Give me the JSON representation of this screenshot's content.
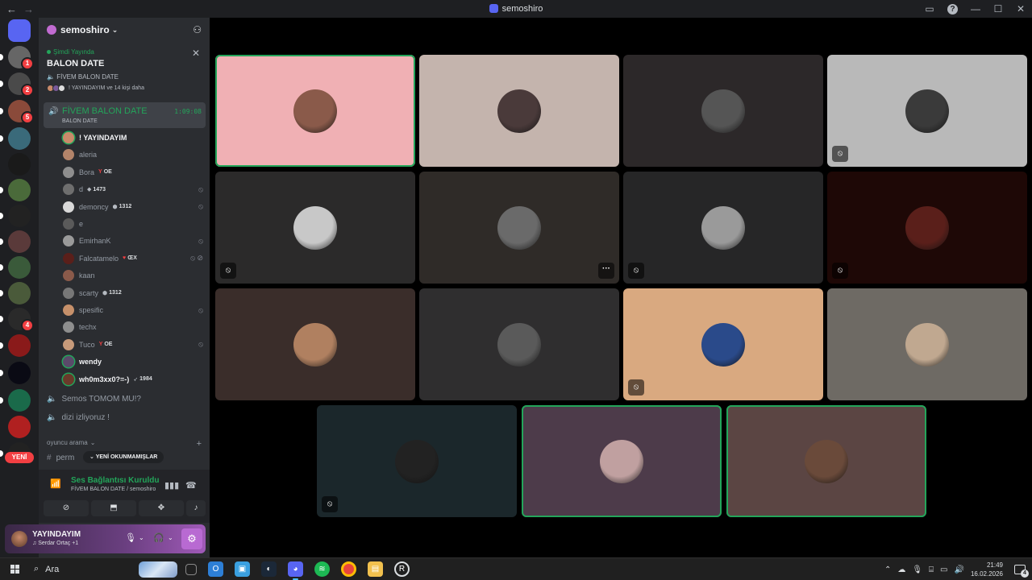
{
  "window": {
    "title": "semoshiro"
  },
  "rail": {
    "badges": [
      "1",
      "2",
      "5",
      "4"
    ],
    "new_label": "YENİ"
  },
  "guild": {
    "name": "semoshiro"
  },
  "live_event": {
    "status": "Şimdi Yayında",
    "name": "BALON DATE",
    "voice_channel": "FİVEM BALON DATE",
    "people_text": "! YAYINDAYIM ve 14 kişi daha"
  },
  "active_channel": {
    "name": "FİVEM BALON DATE",
    "timer": "1:09:08",
    "subtitle": "BALON DATE"
  },
  "members": [
    {
      "name": "! YAYINDAYIM",
      "tag": "",
      "tag_icon": "",
      "icons": "",
      "bright": true,
      "speaking": true,
      "color": "#c98a6a"
    },
    {
      "name": "aleria",
      "tag": "",
      "tag_icon": "",
      "icons": "",
      "bright": false,
      "speaking": false,
      "color": "#b3846a"
    },
    {
      "name": "Bora",
      "tag": "OE",
      "tag_icon": "Y",
      "icons": "",
      "bright": false,
      "speaking": false,
      "color": "#8e8e8e"
    },
    {
      "name": "d",
      "tag": "1473",
      "tag_icon": "◆",
      "icons": "⦸",
      "bright": false,
      "speaking": false,
      "color": "#6e6e6e"
    },
    {
      "name": "demoncy",
      "tag": "1312",
      "tag_icon": "⬢",
      "icons": "⦸",
      "bright": false,
      "speaking": false,
      "color": "#d9d9d9"
    },
    {
      "name": "e",
      "tag": "",
      "tag_icon": "",
      "icons": "",
      "bright": false,
      "speaking": false,
      "color": "#5a5a5a"
    },
    {
      "name": "EmirhanK",
      "tag": "",
      "tag_icon": "",
      "icons": "⦸",
      "bright": false,
      "speaking": false,
      "color": "#9a9a9a"
    },
    {
      "name": "Falcatamelo",
      "tag": "ŒX",
      "tag_icon": "♥",
      "icons": "⦸ ⊘",
      "bright": false,
      "speaking": false,
      "color": "#5a1f1a"
    },
    {
      "name": "kaan",
      "tag": "",
      "tag_icon": "",
      "icons": "",
      "bright": false,
      "speaking": false,
      "color": "#8a5a4a"
    },
    {
      "name": "scarty",
      "tag": "1312",
      "tag_icon": "⬢",
      "icons": "",
      "bright": false,
      "speaking": false,
      "color": "#777777"
    },
    {
      "name": "spesific",
      "tag": "",
      "tag_icon": "",
      "icons": "⦸",
      "bright": false,
      "speaking": false,
      "color": "#c6906a"
    },
    {
      "name": "techx",
      "tag": "",
      "tag_icon": "",
      "icons": "",
      "bright": false,
      "speaking": false,
      "color": "#8e8e8e"
    },
    {
      "name": "Tuco",
      "tag": "OE",
      "tag_icon": "Y",
      "icons": "⦸",
      "bright": false,
      "speaking": false,
      "color": "#c79a7a"
    },
    {
      "name": "wendy",
      "tag": "",
      "tag_icon": "",
      "icons": "",
      "bright": true,
      "speaking": true,
      "color": "#5a4a6a"
    },
    {
      "name": "wh0m3xx0?=-)",
      "tag": "1984",
      "tag_icon": "➶",
      "icons": "",
      "bright": true,
      "speaking": true,
      "color": "#6a3a2a"
    }
  ],
  "channels": [
    {
      "name": "Semos TOMOM MU!?",
      "icon": "🔈"
    },
    {
      "name": "dizi izliyoruz !",
      "icon": "🔈"
    }
  ],
  "category": {
    "name": "oyuncu arama",
    "partial_channel": "perm"
  },
  "unread_pill": "YENİ OKUNMAMIŞLAR",
  "voice_panel": {
    "title": "Ses Bağlantısı Kuruldu",
    "subtitle": "FİVEM BALON DATE / semoshiro"
  },
  "user_panel": {
    "username": "YAYINDAYIM",
    "status": "Serdar Ortaç +1"
  },
  "tiles": [
    {
      "bg": "#f0b0b4",
      "avatar": "#8a5a4a",
      "muted": false,
      "speaking": true,
      "more": false
    },
    {
      "bg": "#c4b4ad",
      "avatar": "#4a3a3a",
      "muted": false,
      "speaking": false,
      "more": false
    },
    {
      "bg": "#2c2829",
      "avatar": "#555555",
      "muted": false,
      "speaking": false,
      "more": false
    },
    {
      "bg": "#b9b9b9",
      "avatar": "#3a3a3a",
      "muted": true,
      "speaking": false,
      "more": false
    },
    {
      "bg": "#2b2a2a",
      "avatar": "#c8c8c8",
      "muted": true,
      "speaking": false,
      "more": false
    },
    {
      "bg": "#2f2b28",
      "avatar": "#6a6a6a",
      "muted": false,
      "speaking": false,
      "more": true
    },
    {
      "bg": "#262627",
      "avatar": "#9a9a9a",
      "muted": true,
      "speaking": false,
      "more": false
    },
    {
      "bg": "#1e0806",
      "avatar": "#5a1f1a",
      "muted": true,
      "speaking": false,
      "more": false
    },
    {
      "bg": "#3a2d2a",
      "avatar": "#b08060",
      "muted": false,
      "speaking": false,
      "more": false
    },
    {
      "bg": "#2f2e2f",
      "avatar": "#5a5a5a",
      "muted": false,
      "speaking": false,
      "more": false
    },
    {
      "bg": "#d9a980",
      "avatar": "#2a4a8a",
      "muted": true,
      "speaking": false,
      "more": false
    },
    {
      "bg": "#6e6a64",
      "avatar": "#c0a890",
      "muted": false,
      "speaking": false,
      "more": false
    },
    {
      "bg": "#1b272b",
      "avatar": "#222222",
      "muted": true,
      "speaking": false,
      "more": false
    },
    {
      "bg": "#4d3b4a",
      "avatar": "#c0a0a0",
      "muted": false,
      "speaking": true,
      "more": false
    },
    {
      "bg": "#5b4543",
      "avatar": "#6a4a3a",
      "muted": false,
      "speaking": true,
      "more": false
    }
  ],
  "taskbar": {
    "search": "Ara",
    "time": "21:49",
    "date": "16.02.2026",
    "notifications": "4"
  }
}
